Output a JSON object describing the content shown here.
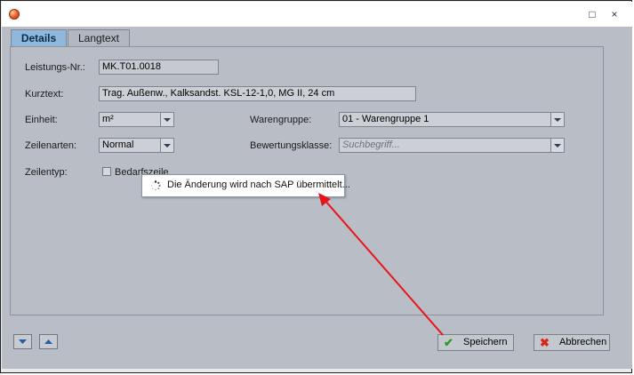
{
  "window": {
    "app_icon": "app-logo-icon",
    "maximize_glyph": "□",
    "close_glyph": "×"
  },
  "tabs": [
    {
      "label": "Details",
      "active": true
    },
    {
      "label": "Langtext",
      "active": false
    }
  ],
  "form": {
    "leistungs_nr_label": "Leistungs-Nr.:",
    "leistungs_nr_value": "MK.T01.0018",
    "kurztext_label": "Kurztext:",
    "kurztext_value": "Trag. Außenw., Kalksandst. KSL-12-1,0, MG II, 24 cm",
    "einheit_label": "Einheit:",
    "einheit_value": "m²",
    "warengruppe_label": "Warengruppe:",
    "warengruppe_value": "01 - Warengruppe 1",
    "zeilenarten_label": "Zeilenarten:",
    "zeilenarten_value": "Normal",
    "bewertungsklasse_label": "Bewertungsklasse:",
    "bewertungsklasse_placeholder": "Suchbegriff...",
    "zeilentyp_label": "Zeilentyp:",
    "bedarfszeile_label": "Bedarfszeile",
    "bedarfszeile_checked": false
  },
  "toast": {
    "message": "Die Änderung wird nach SAP übermittelt..."
  },
  "buttons": {
    "save_label": "Speichern",
    "cancel_label": "Abbrechen"
  },
  "colors": {
    "annotation_arrow": "#e8141a",
    "save_icon": "#2a9a2a",
    "cancel_icon": "#d8281e",
    "active_tab": "#8fb8dc"
  }
}
